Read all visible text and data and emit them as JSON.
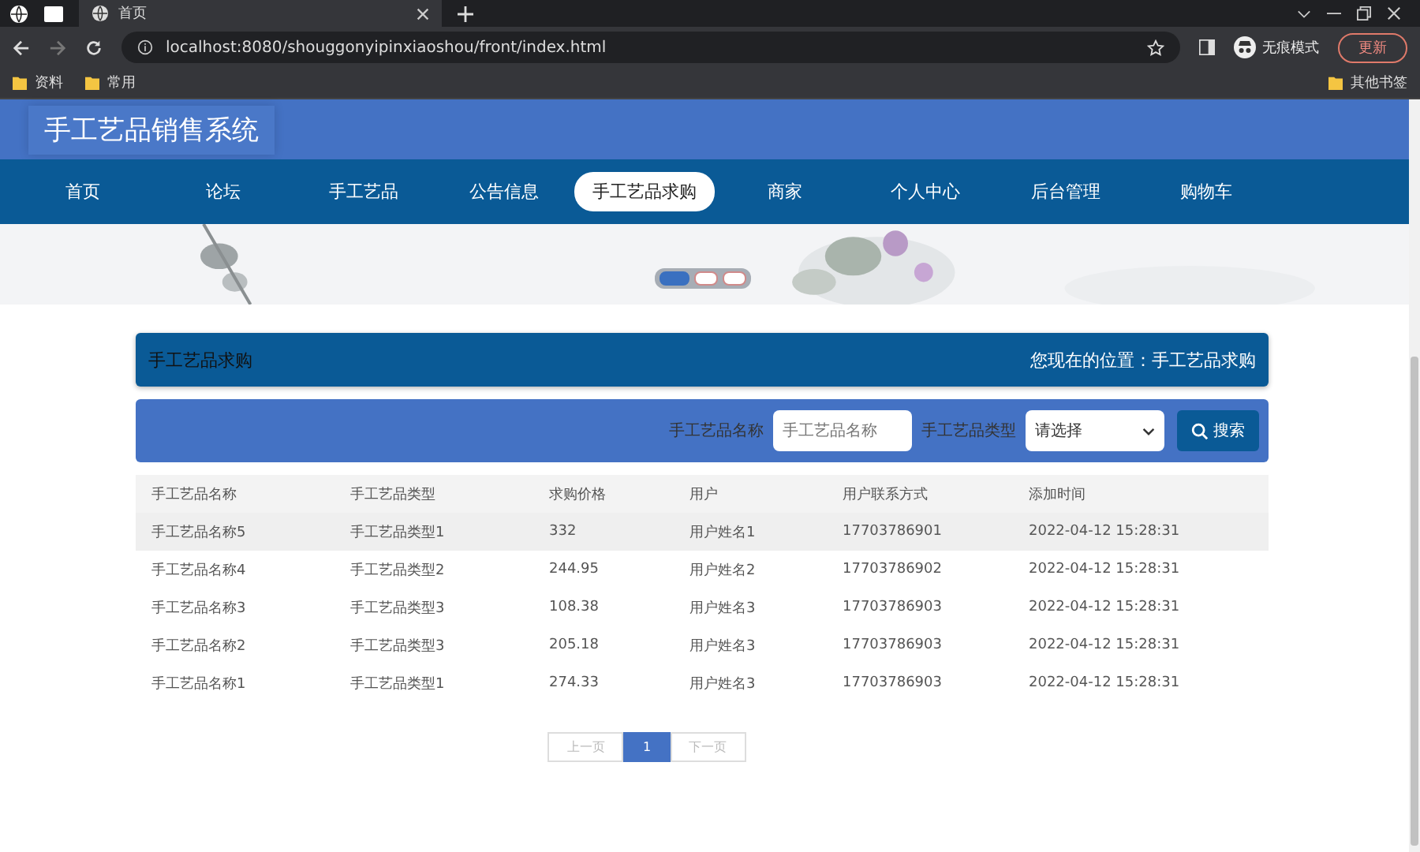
{
  "browser": {
    "tab_title": "首页",
    "url": "localhost:8080/shouggonyipinxiaoshou/front/index.html",
    "incognito_label": "无痕模式",
    "update_button": "更新",
    "bookmarks": [
      "资料",
      "常用"
    ],
    "other_bookmarks": "其他书签"
  },
  "site": {
    "title": "手工艺品销售系统"
  },
  "nav": [
    {
      "label": "首页",
      "selected": false
    },
    {
      "label": "论坛",
      "selected": false
    },
    {
      "label": "手工艺品",
      "selected": false
    },
    {
      "label": "公告信息",
      "selected": false
    },
    {
      "label": "手工艺品求购",
      "selected": true
    },
    {
      "label": "商家",
      "selected": false
    },
    {
      "label": "个人中心",
      "selected": false
    },
    {
      "label": "后台管理",
      "selected": false
    },
    {
      "label": "购物车",
      "selected": false
    }
  ],
  "carousel": [
    {
      "selected": true
    },
    {
      "selected": false
    },
    {
      "selected": false
    }
  ],
  "section": {
    "title": "手工艺品求购",
    "breadcrumb": "您现在的位置：手工艺品求购"
  },
  "search": {
    "name_label": "手工艺品名称",
    "name_placeholder": "手工艺品名称",
    "type_label": "手工艺品类型",
    "type_value": "请选择",
    "button": "搜索"
  },
  "table": {
    "columns": [
      "手工艺品名称",
      "手工艺品类型",
      "求购价格",
      "用户",
      "用户联系方式",
      "添加时间"
    ],
    "rows": [
      {
        "selected": true,
        "cells": [
          "手工艺品名称5",
          "手工艺品类型1",
          "332",
          "用户姓名1",
          "17703786901",
          "2022-04-12 15:28:31"
        ]
      },
      {
        "selected": false,
        "cells": [
          "手工艺品名称4",
          "手工艺品类型2",
          "244.95",
          "用户姓名2",
          "17703786902",
          "2022-04-12 15:28:31"
        ]
      },
      {
        "selected": false,
        "cells": [
          "手工艺品名称3",
          "手工艺品类型3",
          "108.38",
          "用户姓名3",
          "17703786903",
          "2022-04-12 15:28:31"
        ]
      },
      {
        "selected": false,
        "cells": [
          "手工艺品名称2",
          "手工艺品类型3",
          "205.18",
          "用户姓名3",
          "17703786903",
          "2022-04-12 15:28:31"
        ]
      },
      {
        "selected": false,
        "cells": [
          "手工艺品名称1",
          "手工艺品类型1",
          "274.33",
          "用户姓名3",
          "17703786903",
          "2022-04-12 15:28:31"
        ]
      }
    ]
  },
  "pagination": {
    "prev": "上一页",
    "pages": [
      {
        "label": "1",
        "selected": true
      }
    ],
    "next": "下一页"
  }
}
